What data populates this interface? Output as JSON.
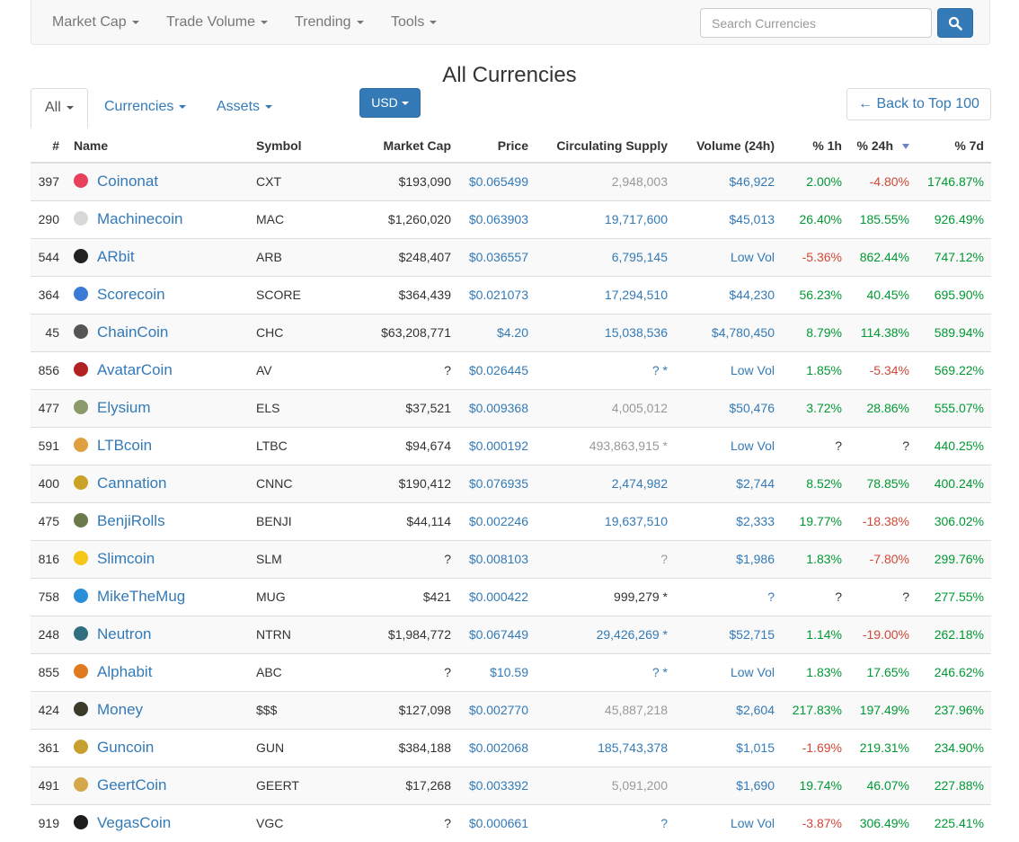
{
  "navbar": {
    "items": [
      "Market Cap",
      "Trade Volume",
      "Trending",
      "Tools"
    ],
    "search_placeholder": "Search Currencies"
  },
  "page_title": "All Currencies",
  "tabs": {
    "all": "All",
    "currencies": "Currencies",
    "assets": "Assets",
    "currency_button": "USD",
    "back_link": "← Back to Top 100"
  },
  "table": {
    "headers": [
      "#",
      "Name",
      "Symbol",
      "Market Cap",
      "Price",
      "Circulating Supply",
      "Volume (24h)",
      "% 1h",
      "% 24h",
      "% 7d"
    ],
    "rows": [
      {
        "rank": "397",
        "name": "Coinonat",
        "symbol": "CXT",
        "market_cap": "$193,090",
        "price": "$0.065499",
        "supply": "2,948,003",
        "supply_style": "grey",
        "volume": "$46,922",
        "h1": "2.00%",
        "h1_class": "pos",
        "h24": "-4.80%",
        "h24_class": "neg",
        "d7": "1746.87%",
        "d7_class": "pos",
        "icon": "coinonat-icon",
        "icon_color": "#e8405a"
      },
      {
        "rank": "290",
        "name": "Machinecoin",
        "symbol": "MAC",
        "market_cap": "$1,260,020",
        "price": "$0.063903",
        "supply": "19,717,600",
        "supply_style": "blue",
        "volume": "$45,013",
        "h1": "26.40%",
        "h1_class": "pos",
        "h24": "185.55%",
        "h24_class": "pos",
        "d7": "926.49%",
        "d7_class": "pos",
        "icon": "machinecoin-icon",
        "icon_color": "#d8d8d8"
      },
      {
        "rank": "544",
        "name": "ARbit",
        "symbol": "ARB",
        "market_cap": "$248,407",
        "price": "$0.036557",
        "supply": "6,795,145",
        "supply_style": "blue",
        "volume": "Low Vol",
        "h1": "-5.36%",
        "h1_class": "neg",
        "h24": "862.44%",
        "h24_class": "pos",
        "d7": "747.12%",
        "d7_class": "pos",
        "icon": "arbit-icon",
        "icon_color": "#222222"
      },
      {
        "rank": "364",
        "name": "Scorecoin",
        "symbol": "SCORE",
        "market_cap": "$364,439",
        "price": "$0.021073",
        "supply": "17,294,510",
        "supply_style": "blue",
        "volume": "$44,230",
        "h1": "56.23%",
        "h1_class": "pos",
        "h24": "40.45%",
        "h24_class": "pos",
        "d7": "695.90%",
        "d7_class": "pos",
        "icon": "scorecoin-icon",
        "icon_color": "#3a7bd5"
      },
      {
        "rank": "45",
        "name": "ChainCoin",
        "symbol": "CHC",
        "market_cap": "$63,208,771",
        "price": "$4.20",
        "supply": "15,038,536",
        "supply_style": "blue",
        "volume": "$4,780,450",
        "h1": "8.79%",
        "h1_class": "pos",
        "h24": "114.38%",
        "h24_class": "pos",
        "d7": "589.94%",
        "d7_class": "pos",
        "icon": "chaincoin-icon",
        "icon_color": "#555555"
      },
      {
        "rank": "856",
        "name": "AvatarCoin",
        "symbol": "AV",
        "market_cap": "?",
        "price": "$0.026445",
        "supply": "? *",
        "supply_style": "blue",
        "volume": "Low Vol",
        "h1": "1.85%",
        "h1_class": "pos",
        "h24": "-5.34%",
        "h24_class": "neg",
        "d7": "569.22%",
        "d7_class": "pos",
        "icon": "avatarcoin-icon",
        "icon_color": "#b22222"
      },
      {
        "rank": "477",
        "name": "Elysium",
        "symbol": "ELS",
        "market_cap": "$37,521",
        "price": "$0.009368",
        "supply": "4,005,012",
        "supply_style": "grey",
        "volume": "$50,476",
        "h1": "3.72%",
        "h1_class": "pos",
        "h24": "28.86%",
        "h24_class": "pos",
        "d7": "555.07%",
        "d7_class": "pos",
        "icon": "elysium-icon",
        "icon_color": "#8a9a6a"
      },
      {
        "rank": "591",
        "name": "LTBcoin",
        "symbol": "LTBC",
        "market_cap": "$94,674",
        "price": "$0.000192",
        "supply": "493,863,915 *",
        "supply_style": "grey",
        "volume": "Low Vol",
        "h1": "?",
        "h1_class": "plain",
        "h24": "?",
        "h24_class": "plain",
        "d7": "440.25%",
        "d7_class": "pos",
        "icon": "ltbcoin-icon",
        "icon_color": "#e0a040"
      },
      {
        "rank": "400",
        "name": "Cannation",
        "symbol": "CNNC",
        "market_cap": "$190,412",
        "price": "$0.076935",
        "supply": "2,474,982",
        "supply_style": "blue",
        "volume": "$2,744",
        "h1": "8.52%",
        "h1_class": "pos",
        "h24": "78.85%",
        "h24_class": "pos",
        "d7": "400.24%",
        "d7_class": "pos",
        "icon": "cannation-icon",
        "icon_color": "#c9a227"
      },
      {
        "rank": "475",
        "name": "BenjiRolls",
        "symbol": "BENJI",
        "market_cap": "$44,114",
        "price": "$0.002246",
        "supply": "19,637,510",
        "supply_style": "blue",
        "volume": "$2,333",
        "h1": "19.77%",
        "h1_class": "pos",
        "h24": "-18.38%",
        "h24_class": "neg",
        "d7": "306.02%",
        "d7_class": "pos",
        "icon": "benjirolls-icon",
        "icon_color": "#6b7a4a"
      },
      {
        "rank": "816",
        "name": "Slimcoin",
        "symbol": "SLM",
        "market_cap": "?",
        "price": "$0.008103",
        "supply": "?",
        "supply_style": "grey",
        "volume": "$1,986",
        "h1": "1.83%",
        "h1_class": "pos",
        "h24": "-7.80%",
        "h24_class": "neg",
        "d7": "299.76%",
        "d7_class": "pos",
        "icon": "slimcoin-icon",
        "icon_color": "#f5c518"
      },
      {
        "rank": "758",
        "name": "MikeTheMug",
        "symbol": "MUG",
        "market_cap": "$421",
        "price": "$0.000422",
        "supply": "999,279 *",
        "supply_style": "plain",
        "volume": "?",
        "h1": "?",
        "h1_class": "plain",
        "h24": "?",
        "h24_class": "plain",
        "d7": "277.55%",
        "d7_class": "pos",
        "icon": "mikethemug-icon",
        "icon_color": "#2a8fd8"
      },
      {
        "rank": "248",
        "name": "Neutron",
        "symbol": "NTRN",
        "market_cap": "$1,984,772",
        "price": "$0.067449",
        "supply": "29,426,269 *",
        "supply_style": "blue",
        "volume": "$52,715",
        "h1": "1.14%",
        "h1_class": "pos",
        "h24": "-19.00%",
        "h24_class": "neg",
        "d7": "262.18%",
        "d7_class": "pos",
        "icon": "neutron-icon",
        "icon_color": "#2f6f7f"
      },
      {
        "rank": "855",
        "name": "Alphabit",
        "symbol": "ABC",
        "market_cap": "?",
        "price": "$10.59",
        "supply": "? *",
        "supply_style": "blue",
        "volume": "Low Vol",
        "h1": "1.83%",
        "h1_class": "pos",
        "h24": "17.65%",
        "h24_class": "pos",
        "d7": "246.62%",
        "d7_class": "pos",
        "icon": "alphabit-icon",
        "icon_color": "#e07a20"
      },
      {
        "rank": "424",
        "name": "Money",
        "symbol": "$$$",
        "market_cap": "$127,098",
        "price": "$0.002770",
        "supply": "45,887,218",
        "supply_style": "grey",
        "volume": "$2,604",
        "h1": "217.83%",
        "h1_class": "pos",
        "h24": "197.49%",
        "h24_class": "pos",
        "d7": "237.96%",
        "d7_class": "pos",
        "icon": "money-icon",
        "icon_color": "#3b3b2b"
      },
      {
        "rank": "361",
        "name": "Guncoin",
        "symbol": "GUN",
        "market_cap": "$384,188",
        "price": "$0.002068",
        "supply": "185,743,378",
        "supply_style": "blue",
        "volume": "$1,015",
        "h1": "-1.69%",
        "h1_class": "neg",
        "h24": "219.31%",
        "h24_class": "pos",
        "d7": "234.90%",
        "d7_class": "pos",
        "icon": "guncoin-icon",
        "icon_color": "#c8a030"
      },
      {
        "rank": "491",
        "name": "GeertCoin",
        "symbol": "GEERT",
        "market_cap": "$17,268",
        "price": "$0.003392",
        "supply": "5,091,200",
        "supply_style": "grey",
        "volume": "$1,690",
        "h1": "19.74%",
        "h1_class": "pos",
        "h24": "46.07%",
        "h24_class": "pos",
        "d7": "227.88%",
        "d7_class": "pos",
        "icon": "geertcoin-icon",
        "icon_color": "#d4a84a"
      },
      {
        "rank": "919",
        "name": "VegasCoin",
        "symbol": "VGC",
        "market_cap": "?",
        "price": "$0.000661",
        "supply": "?",
        "supply_style": "blue",
        "volume": "Low Vol",
        "h1": "-3.87%",
        "h1_class": "neg",
        "h24": "306.49%",
        "h24_class": "pos",
        "d7": "225.41%",
        "d7_class": "pos",
        "icon": "vegascoin-icon",
        "icon_color": "#1e1e1e"
      }
    ]
  }
}
